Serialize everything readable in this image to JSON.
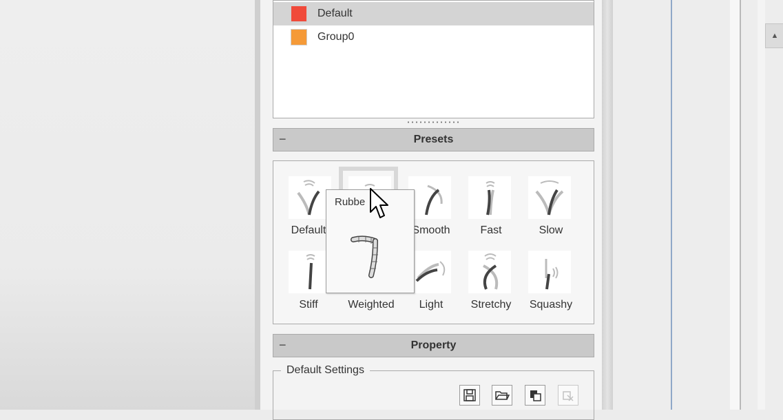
{
  "groups": [
    {
      "label": "Default",
      "color": "#f04a3a",
      "selected": true
    },
    {
      "label": "Group0",
      "color": "#f59a38",
      "selected": false
    }
  ],
  "presets_section": {
    "title": "Presets",
    "collapse_glyph": "−"
  },
  "presets": [
    {
      "label": "Default",
      "icon": "spring-default-icon"
    },
    {
      "label": "Rubber",
      "icon": "spring-rubber-icon"
    },
    {
      "label": "Smooth",
      "icon": "spring-smooth-icon"
    },
    {
      "label": "Fast",
      "icon": "spring-fast-icon"
    },
    {
      "label": "Slow",
      "icon": "spring-slow-icon"
    },
    {
      "label": "Stiff",
      "icon": "spring-stiff-icon"
    },
    {
      "label": "Weighted",
      "icon": "spring-weighted-icon"
    },
    {
      "label": "Light",
      "icon": "spring-light-icon"
    },
    {
      "label": "Stretchy",
      "icon": "spring-stretchy-icon"
    },
    {
      "label": "Squashy",
      "icon": "spring-squashy-icon"
    }
  ],
  "tooltip": {
    "title": "Rubbe"
  },
  "property_section": {
    "title": "Property",
    "collapse_glyph": "−"
  },
  "default_settings": {
    "title": "Default Settings"
  },
  "toolbar": [
    {
      "icon": "save-icon",
      "enabled": true
    },
    {
      "icon": "open-folder-icon",
      "enabled": true
    },
    {
      "icon": "copy-icon",
      "enabled": true
    },
    {
      "icon": "paste-icon",
      "enabled": false
    }
  ],
  "scrollbar": {
    "up_glyph": "▲"
  }
}
